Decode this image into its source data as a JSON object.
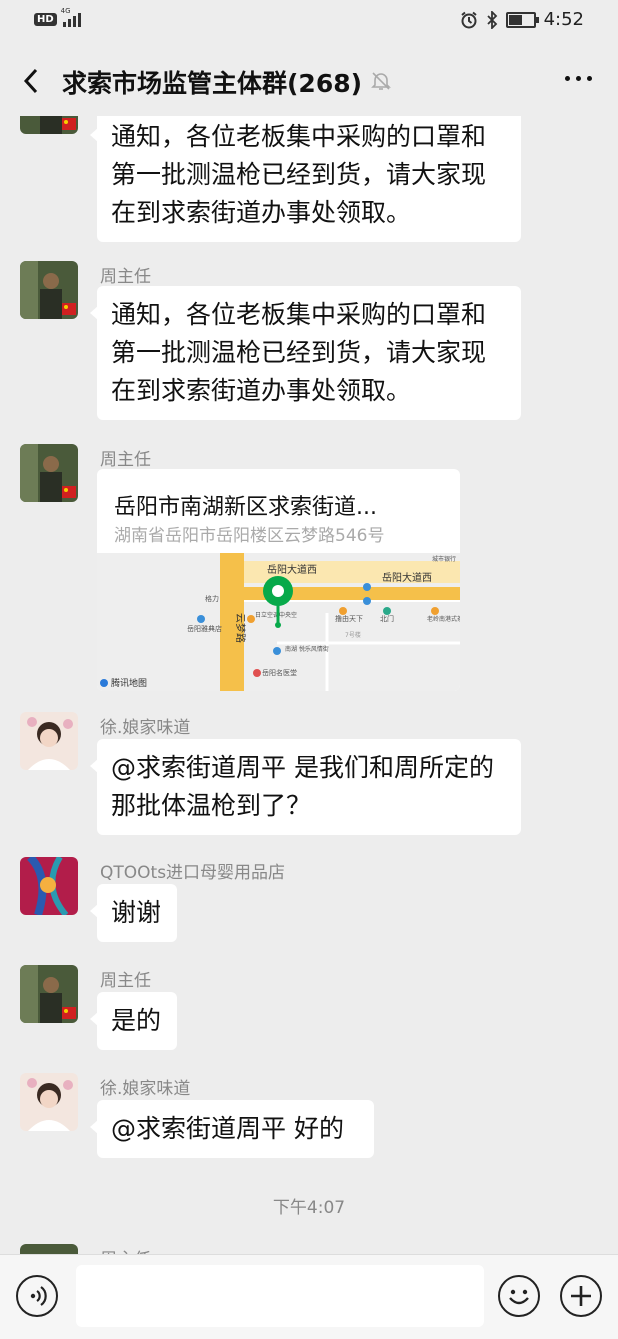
{
  "status_bar": {
    "hd": "HD",
    "network": "4G",
    "time": "4:52",
    "battery_level": 0.6
  },
  "header": {
    "title": "求索市场监管主体群(268)"
  },
  "messages": [
    {
      "sender": "",
      "lines": [
        "通知，各位老板集中采购的口罩和",
        "第一批测温枪已经到货，请大家现",
        "在到求索街道办事处领取。"
      ]
    },
    {
      "sender": "周主任",
      "lines": [
        "通知，各位老板集中采购的口罩和",
        "第一批测温枪已经到货，请大家现",
        "在到求索街道办事处领取。"
      ]
    },
    {
      "sender": "周主任",
      "location": {
        "title": "岳阳市南湖新区求索街道...",
        "address": "湖南省岳阳市岳阳楼区云梦路546号",
        "map_labels": {
          "road_h1": "岳阳大道西",
          "road_h2": "岳阳大道西",
          "road_v": "云梦路",
          "poi1": "格力",
          "poi2": "岳阳雅典店",
          "poi3": "日立空调中央空",
          "poi4": "撸由天下",
          "poi5": "北门",
          "poi6": "老岭南港式茶餐厅",
          "poi7": "7号楼",
          "poi8": "南湖 悦乐风情街",
          "poi9": "岳阳名医堂",
          "poi10": "城市银行",
          "brand": "腾讯地图"
        }
      }
    },
    {
      "sender": "徐.娘家味道",
      "lines": [
        "@求索街道周平  是我们和周所定的",
        "那批体温枪到了？"
      ]
    },
    {
      "sender": "QTOOts进口母婴用品店",
      "lines": [
        "谢谢"
      ]
    },
    {
      "sender": "周主任",
      "lines": [
        "是的"
      ]
    },
    {
      "sender": "徐.娘家味道",
      "lines": [
        "@求索街道周平  好的"
      ]
    },
    {
      "sender": "周主任",
      "partial": true
    }
  ],
  "timestamp": "下午4:07",
  "input": {
    "placeholder": ""
  },
  "colors": {
    "background": "#ededed",
    "bubble": "#ffffff",
    "map_pin": "#07a94a",
    "map_road": "#f5c04a"
  }
}
